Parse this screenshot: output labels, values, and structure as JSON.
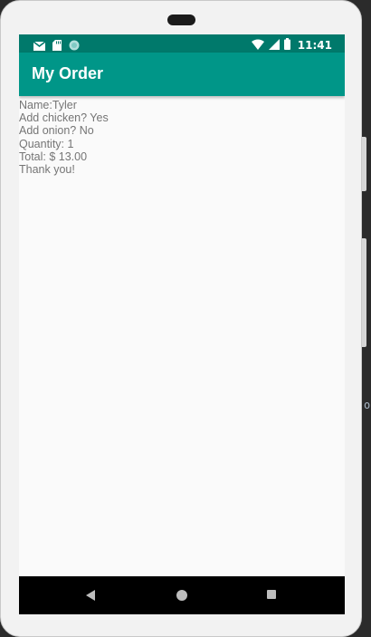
{
  "status_bar": {
    "time": "11:41",
    "left_icons": [
      "gmail-icon",
      "sd-card-icon",
      "sync-circle-icon"
    ],
    "right_icons": [
      "wifi-icon",
      "signal-icon",
      "battery-icon"
    ]
  },
  "app_bar": {
    "title": "My Order"
  },
  "order_summary": {
    "lines": [
      "Name:Tyler",
      "Add chicken? Yes",
      "Add onion? No",
      "Quantity: 1",
      "Total: $ 13.00",
      "Thank you!"
    ]
  },
  "nav_bar": {
    "buttons": [
      "back-icon",
      "home-icon",
      "recents-icon"
    ]
  },
  "ide_background": {
    "text": "ot"
  },
  "colors": {
    "status_bar": "#00796b",
    "app_bar": "#009688",
    "content_text": "#757575",
    "screen_background": "#fafafa"
  }
}
